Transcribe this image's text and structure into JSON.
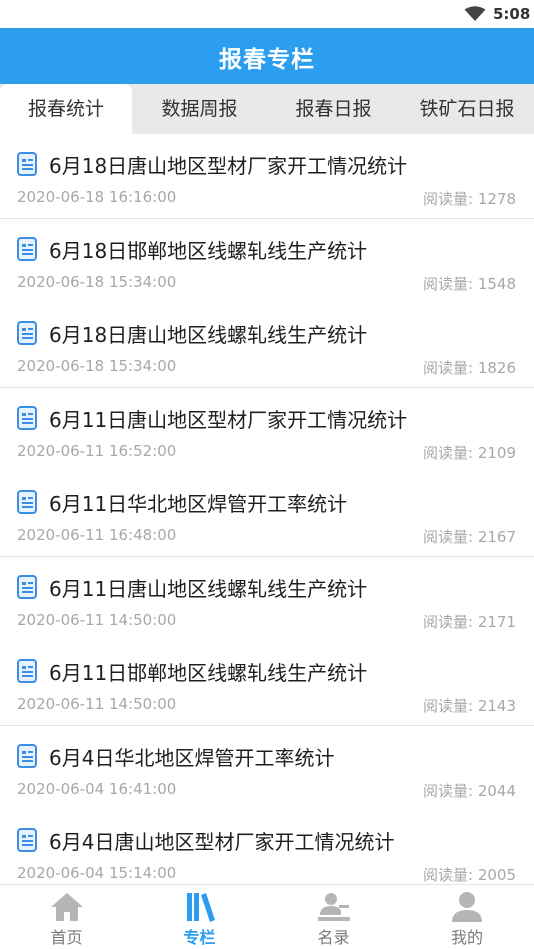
{
  "status_bar": {
    "time": "5:08"
  },
  "header": {
    "title": "报春专栏"
  },
  "tabs": [
    {
      "label": "报春统计",
      "active": true
    },
    {
      "label": "数据周报",
      "active": false
    },
    {
      "label": "报春日报",
      "active": false
    },
    {
      "label": "铁矿石日报",
      "active": false
    }
  ],
  "articles": [
    {
      "title": "6月18日唐山地区型材厂家开工情况统计",
      "time": "2020-06-18 16:16:00",
      "reads": "阅读量: 1278"
    },
    {
      "title": "6月18日邯郸地区线螺轧线生产统计",
      "time": "2020-06-18 15:34:00",
      "reads": "阅读量: 1548"
    },
    {
      "title": "6月18日唐山地区线螺轧线生产统计",
      "time": "2020-06-18 15:34:00",
      "reads": "阅读量: 1826"
    },
    {
      "title": "6月11日唐山地区型材厂家开工情况统计",
      "time": "2020-06-11 16:52:00",
      "reads": "阅读量: 2109"
    },
    {
      "title": "6月11日华北地区焊管开工率统计",
      "time": "2020-06-11 16:48:00",
      "reads": "阅读量: 2167"
    },
    {
      "title": "6月11日唐山地区线螺轧线生产统计",
      "time": "2020-06-11 14:50:00",
      "reads": "阅读量: 2171"
    },
    {
      "title": "6月11日邯郸地区线螺轧线生产统计",
      "time": "2020-06-11 14:50:00",
      "reads": "阅读量: 2143"
    },
    {
      "title": "6月4日华北地区焊管开工率统计",
      "time": "2020-06-04 16:41:00",
      "reads": "阅读量: 2044"
    },
    {
      "title": "6月4日唐山地区型材厂家开工情况统计",
      "time": "2020-06-04 15:14:00",
      "reads": "阅读量: 2005"
    }
  ],
  "bottom_nav": [
    {
      "label": "首页",
      "icon": "home-icon",
      "active": false
    },
    {
      "label": "专栏",
      "icon": "books-icon",
      "active": true
    },
    {
      "label": "名录",
      "icon": "directory-icon",
      "active": false
    },
    {
      "label": "我的",
      "icon": "person-icon",
      "active": false
    }
  ],
  "colors": {
    "accent": "#2c9ef0",
    "inactive": "#b5b5b5",
    "doc_icon": "#3a8ee6"
  }
}
